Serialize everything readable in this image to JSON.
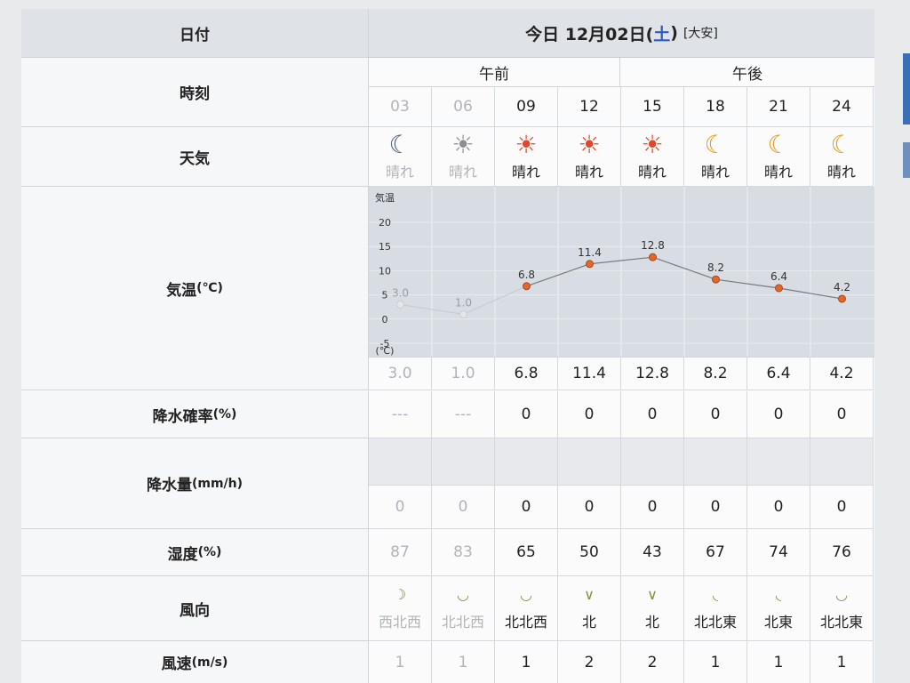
{
  "header": {
    "date_label": "日付",
    "date_title_prefix": "今日 12月02日(",
    "date_title_day": "土",
    "date_title_suffix": ")",
    "rokuyo": "[大安]"
  },
  "rows": {
    "time": "時刻",
    "weather": "天気",
    "temperature": "気温",
    "temperature_unit": "(℃)",
    "rain_prob": "降水確率",
    "rain_prob_unit": "(%)",
    "rain_amount": "降水量",
    "rain_amount_unit": "(mm/h)",
    "humidity": "湿度",
    "humidity_unit": "(%)",
    "wind_dir": "風向",
    "wind_speed": "風速",
    "wind_speed_unit": "(m/s)"
  },
  "periods": {
    "am": "午前",
    "pm": "午後"
  },
  "slots": [
    {
      "hour": "03",
      "past": true,
      "icon": "moon-star-icon",
      "glyph": "☾",
      "weather": "晴れ",
      "temp": "3.0",
      "rain": "---",
      "amount": "0",
      "humidity": "87",
      "arrow": "☽",
      "wind_dir": "西北西",
      "wind_speed": "1"
    },
    {
      "hour": "06",
      "past": true,
      "icon": "sun-icon",
      "glyph": "☀",
      "weather": "晴れ",
      "temp": "1.0",
      "rain": "---",
      "amount": "0",
      "humidity": "83",
      "arrow": "◡",
      "wind_dir": "北北西",
      "wind_speed": "1"
    },
    {
      "hour": "09",
      "past": false,
      "icon": "sun-icon",
      "glyph": "☀",
      "weather": "晴れ",
      "temp": "6.8",
      "rain": "0",
      "amount": "0",
      "humidity": "65",
      "arrow": "◡",
      "wind_dir": "北北西",
      "wind_speed": "1"
    },
    {
      "hour": "12",
      "past": false,
      "icon": "sun-icon",
      "glyph": "☀",
      "weather": "晴れ",
      "temp": "11.4",
      "rain": "0",
      "amount": "0",
      "humidity": "50",
      "arrow": "∨",
      "wind_dir": "北",
      "wind_speed": "2"
    },
    {
      "hour": "15",
      "past": false,
      "icon": "sun-icon",
      "glyph": "☀",
      "weather": "晴れ",
      "temp": "12.8",
      "rain": "0",
      "amount": "0",
      "humidity": "43",
      "arrow": "∨",
      "wind_dir": "北",
      "wind_speed": "2"
    },
    {
      "hour": "18",
      "past": false,
      "icon": "moon-star-icon",
      "glyph": "☾",
      "weather": "晴れ",
      "temp": "8.2",
      "rain": "0",
      "amount": "0",
      "humidity": "67",
      "arrow": "◟",
      "wind_dir": "北北東",
      "wind_speed": "1"
    },
    {
      "hour": "21",
      "past": false,
      "icon": "moon-star-icon",
      "glyph": "☾",
      "weather": "晴れ",
      "temp": "6.4",
      "rain": "0",
      "amount": "0",
      "humidity": "74",
      "arrow": "◟",
      "wind_dir": "北東",
      "wind_speed": "1"
    },
    {
      "hour": "24",
      "past": false,
      "icon": "moon-star-icon",
      "glyph": "☾",
      "weather": "晴れ",
      "temp": "4.2",
      "rain": "0",
      "amount": "0",
      "humidity": "76",
      "arrow": "◡",
      "wind_dir": "北北東",
      "wind_speed": "1"
    }
  ],
  "colors": {
    "sun": "#e2452a",
    "moon": "#e39a1d",
    "moon_past": "#4b5b7c",
    "sun_past": "#8a8f96",
    "line": "#777a7f",
    "point": "#e2682a",
    "point_past": "#c9ccd0"
  },
  "chart_data": {
    "type": "line",
    "title": "気温",
    "ylabel": "(℃)",
    "yticks": [
      "20",
      "15",
      "10",
      "5",
      "0",
      "-5"
    ],
    "ylim": [
      -5,
      20
    ],
    "categories": [
      "03",
      "06",
      "09",
      "12",
      "15",
      "18",
      "21",
      "24"
    ],
    "values": [
      3.0,
      1.0,
      6.8,
      11.4,
      12.8,
      8.2,
      6.4,
      4.2
    ],
    "labels": [
      "3.0",
      "1.0",
      "6.8",
      "11.4",
      "12.8",
      "8.2",
      "6.4",
      "4.2"
    ],
    "past_count": 2
  }
}
